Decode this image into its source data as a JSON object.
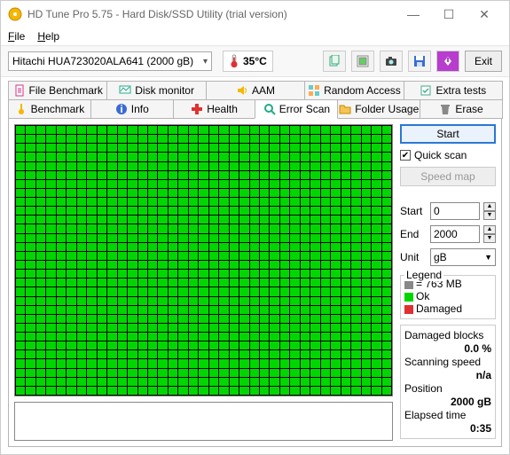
{
  "window": {
    "title": "HD Tune Pro 5.75 - Hard Disk/SSD Utility (trial version)"
  },
  "menu": {
    "file": "File",
    "help": "Help"
  },
  "toolbar": {
    "drive": "Hitachi HUA723020ALA641 (2000 gB)",
    "temp": "35°C",
    "exit": "Exit"
  },
  "tabs": {
    "row1": [
      "File Benchmark",
      "Disk monitor",
      "AAM",
      "Random Access",
      "Extra tests"
    ],
    "row2": [
      "Benchmark",
      "Info",
      "Health",
      "Error Scan",
      "Folder Usage",
      "Erase"
    ]
  },
  "scan": {
    "start_btn": "Start",
    "quickscan": "Quick scan",
    "speedmap": "Speed map",
    "start_label": "Start",
    "end_label": "End",
    "start_val": "0",
    "end_val": "2000",
    "unit_label": "Unit",
    "unit_val": "gB",
    "legend": {
      "title": "Legend",
      "block": "= 763 MB",
      "ok": "Ok",
      "damaged": "Damaged"
    },
    "stats": {
      "damaged_label": "Damaged blocks",
      "damaged_val": "0.0 %",
      "speed_label": "Scanning speed",
      "speed_val": "n/a",
      "pos_label": "Position",
      "pos_val": "2000 gB",
      "elapsed_label": "Elapsed time",
      "elapsed_val": "0:35"
    }
  }
}
